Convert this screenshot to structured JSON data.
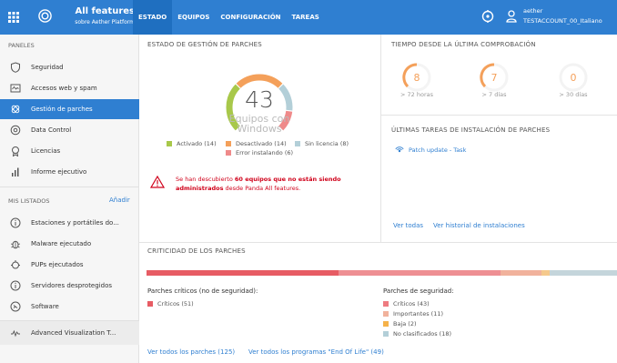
{
  "header": {
    "title": "All features",
    "subtitle": "sobre Aether Platform",
    "tabs": [
      {
        "label": "ESTADO",
        "active": true
      },
      {
        "label": "EQUIPOS",
        "active": false
      },
      {
        "label": "CONFIGURACIÓN",
        "active": false
      },
      {
        "label": "TAREAS",
        "active": false
      }
    ],
    "user_name": "aether",
    "account": "TESTACCOUNT_00_Italiano",
    "accent_color": "#2f7fd1"
  },
  "sidebar": {
    "panels_heading": "PANELES",
    "items": [
      {
        "label": "Seguridad",
        "icon": "shield-icon"
      },
      {
        "label": "Accesos web y spam",
        "icon": "web-access-icon"
      },
      {
        "label": "Gestión de parches",
        "icon": "patch-icon",
        "active": true
      },
      {
        "label": "Data Control",
        "icon": "data-control-icon"
      },
      {
        "label": "Licencias",
        "icon": "license-icon"
      },
      {
        "label": "Informe ejecutivo",
        "icon": "bar-chart-icon"
      }
    ],
    "lists_heading": "MIS LISTADOS",
    "add_label": "Añadir",
    "lists": [
      {
        "label": "Estaciones y portátiles do...",
        "icon": "info-icon"
      },
      {
        "label": "Malware ejecutado",
        "icon": "bug-icon"
      },
      {
        "label": "PUPs ejecutados",
        "icon": "pup-icon"
      },
      {
        "label": "Servidores desprotegidos",
        "icon": "info-icon"
      },
      {
        "label": "Software",
        "icon": "software-icon"
      }
    ],
    "extra_item": {
      "label": "Advanced Visualization T...",
      "icon": "wave-icon"
    }
  },
  "patch_status": {
    "title": "ESTADO DE GESTIÓN DE PARCHES",
    "total": "43",
    "total_label_1": "Equipos con",
    "total_label_2": "Windows",
    "legend": [
      {
        "label": "Activado (14)",
        "color": "#a8c84a"
      },
      {
        "label": "Desactivado (14)",
        "color": "#f4a05a"
      },
      {
        "label": "Sin licencia (8)",
        "color": "#b3cfd8"
      },
      {
        "label": "Error instalando (6)",
        "color": "#ef8a8a"
      }
    ],
    "gauge_values": [
      14,
      14,
      8,
      6
    ],
    "warning_text_1": "Se han descubierto",
    "warning_bold": "60 equipos que no están siendo administrados",
    "warning_text_2": "desde Panda All features."
  },
  "time_check": {
    "title": "TIEMPO DESDE LA ÚLTIMA COMPROBACIÓN",
    "items": [
      {
        "value": "8",
        "label": "> 72 horas"
      },
      {
        "value": "7",
        "label": "> 7 días"
      },
      {
        "value": "0",
        "label": "> 30 días"
      }
    ]
  },
  "last_tasks": {
    "title": "ÚLTIMAS TAREAS DE INSTALACIÓN DE PARCHES",
    "task": "Patch update - Task",
    "view_all": "Ver todas",
    "view_history": "Ver historial de instalaciones"
  },
  "criticality": {
    "title": "CRITICIDAD DE LOS PARCHES",
    "bar": [
      {
        "value": 51,
        "color": "#e75c64"
      },
      {
        "value": 43,
        "color": "#ee8f93"
      },
      {
        "value": 11,
        "color": "#f1b29c"
      },
      {
        "value": 2,
        "color": "#f5c98c"
      },
      {
        "value": 18,
        "color": "#c4d5db"
      }
    ],
    "critical_title": "Parches críticos (no de seguridad):",
    "critical_items": [
      {
        "label": "Críticos (51)",
        "color": "#e75c64"
      }
    ],
    "security_title": "Parches de seguridad:",
    "security_items": [
      {
        "label": "Críticos (43)",
        "color": "#ee7b80"
      },
      {
        "label": "Importantes (11)",
        "color": "#f1b29c"
      },
      {
        "label": "Baja (2)",
        "color": "#f5b24a"
      },
      {
        "label": "No clasificados (18)",
        "color": "#b3cfd8"
      }
    ],
    "view_all_patches": "Ver todos los parches (125)",
    "view_eol": "Ver todos los programas \"End Of Life\" (49)"
  }
}
